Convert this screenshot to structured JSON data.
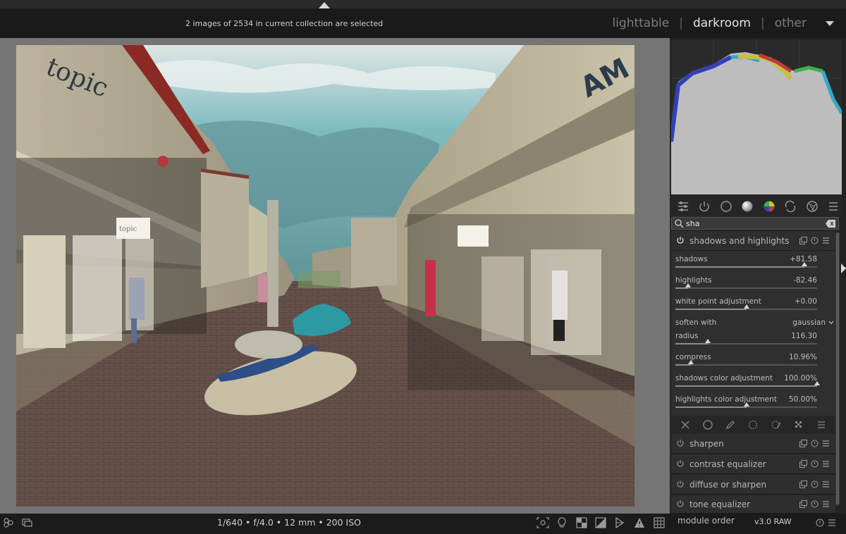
{
  "header": {
    "selection_info": "2 images of 2534 in current collection are selected",
    "views": [
      "lighttable",
      "darkroom",
      "other"
    ],
    "active_view": "darkroom"
  },
  "photo": {
    "signs": [
      "topic",
      "AM",
      "topic"
    ]
  },
  "search": {
    "value": "sha"
  },
  "active_module": {
    "title": "shadows and highlights",
    "params": [
      {
        "label": "shadows",
        "value": "+81.58",
        "level": 0.91
      },
      {
        "label": "highlights",
        "value": "-82.46",
        "level": 0.09
      },
      {
        "label": "white point adjustment",
        "value": "+0.00",
        "level": 0.5
      },
      {
        "label": "soften with",
        "value": "gaussian"
      },
      {
        "label": "radius",
        "value": "116.30",
        "level": 0.23
      },
      {
        "label": "compress",
        "value": "10.96%",
        "level": 0.11
      },
      {
        "label": "shadows color adjustment",
        "value": "100.00%",
        "level": 1.0
      },
      {
        "label": "highlights color adjustment",
        "value": "50.00%",
        "level": 0.5
      }
    ]
  },
  "modules": [
    {
      "title": "sharpen"
    },
    {
      "title": "contrast equalizer"
    },
    {
      "title": "diffuse or sharpen"
    },
    {
      "title": "tone equalizer"
    }
  ],
  "footer": {
    "exif": "1/640 • f/4.0 • 12 mm • 200 ISO",
    "module_order_label": "module order",
    "module_order_value": "v3.0 RAW"
  },
  "colors": {
    "accent": "#e6e6e6",
    "panel": "#2f2f2f",
    "background": "#757575"
  }
}
